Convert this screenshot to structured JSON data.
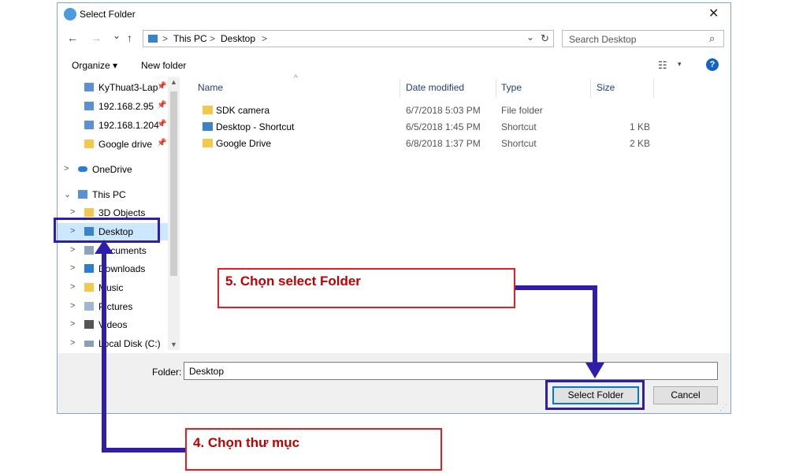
{
  "window": {
    "title": "Select Folder",
    "close_glyph": "✕"
  },
  "nav_buttons": {
    "back": "←",
    "forward": "→",
    "recent": "⌄",
    "up": "↑"
  },
  "address": {
    "crumbs": [
      "This PC",
      "Desktop"
    ],
    "sep": ">",
    "dropdown": "⌄",
    "refresh": "↻"
  },
  "search": {
    "placeholder": "Search Desktop",
    "icon": "⌕"
  },
  "toolbar": {
    "organize": "Organize ▾",
    "new_folder": "New folder",
    "help": "?",
    "view_icon": "☷",
    "view_drop": "▾"
  },
  "nav_pane": {
    "items": [
      {
        "label": "KyThuat3-Lap",
        "icon": "computer-icon",
        "pinned": true,
        "chevron": ""
      },
      {
        "label": "192.168.2.95",
        "icon": "computer-icon",
        "pinned": true,
        "chevron": ""
      },
      {
        "label": "192.168.1.204",
        "icon": "computer-icon",
        "pinned": true,
        "chevron": ""
      },
      {
        "label": "Google drive",
        "icon": "folder-icon",
        "pinned": true,
        "chevron": ""
      },
      {
        "label": "OneDrive",
        "icon": "cloud-icon",
        "pinned": false,
        "chevron": ">"
      },
      {
        "label": "This PC",
        "icon": "computer-icon",
        "pinned": false,
        "chevron": "⌄"
      },
      {
        "label": "3D Objects",
        "icon": "folder-icon",
        "pinned": false,
        "chevron": ">"
      },
      {
        "label": "Desktop",
        "icon": "folder-icon",
        "pinned": false,
        "chevron": ">"
      },
      {
        "label": "Documents",
        "icon": "document-icon",
        "pinned": false,
        "chevron": ">"
      },
      {
        "label": "Downloads",
        "icon": "download-icon",
        "pinned": false,
        "chevron": ">"
      },
      {
        "label": "Music",
        "icon": "music-icon",
        "pinned": false,
        "chevron": ">"
      },
      {
        "label": "Pictures",
        "icon": "picture-icon",
        "pinned": false,
        "chevron": ">"
      },
      {
        "label": "Videos",
        "icon": "video-icon",
        "pinned": false,
        "chevron": ">"
      },
      {
        "label": "Local Disk (C:)",
        "icon": "disk-icon",
        "pinned": false,
        "chevron": ">"
      }
    ],
    "pin_glyph": "📌",
    "selected": "Desktop"
  },
  "file_list": {
    "columns": [
      "Name",
      "Date modified",
      "Type",
      "Size"
    ],
    "sort_glyph": "^",
    "rows": [
      {
        "name": "SDK camera",
        "date": "6/7/2018 5:03 PM",
        "type": "File folder",
        "size": "",
        "icon": "folder-icon"
      },
      {
        "name": "Desktop - Shortcut",
        "date": "6/5/2018 1:45 PM",
        "type": "Shortcut",
        "size": "1 KB",
        "icon": "shortcut-icon"
      },
      {
        "name": "Google Drive",
        "date": "6/8/2018 1:37 PM",
        "type": "Shortcut",
        "size": "2 KB",
        "icon": "shortcut-icon"
      }
    ]
  },
  "bottom": {
    "folder_label": "Folder:",
    "folder_value": "Desktop",
    "select_button": "Select Folder",
    "cancel_button": "Cancel"
  },
  "annotations": {
    "step5": "5. Chọn select Folder",
    "step4": "4. Chọn thư mục"
  },
  "colors": {
    "accent": "#0078d7",
    "highlight_box": "#2f1fa8",
    "callout_border": "#e21f26",
    "callout_text": "#c00000",
    "selected_bg": "#cce8ff"
  }
}
